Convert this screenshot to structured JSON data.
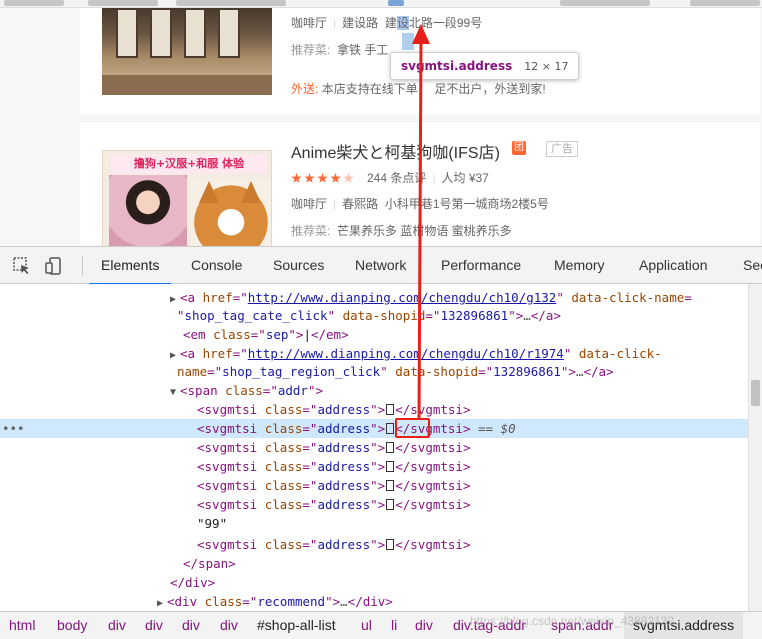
{
  "page": {
    "shop1": {
      "tags_line": {
        "category": "咖啡厅",
        "region": "建设路",
        "address_prefix": "建",
        "address_highlight": "设",
        "address_rest": "北路一段99号"
      },
      "recommend_label": "推荐菜:",
      "recommend_items": "拿铁 手工",
      "delivery_label": "外送:",
      "delivery_text": "本店支持在线下单",
      "delivery_text2": "足不出户，外送到家!"
    },
    "shop2": {
      "thumb_banner": "撸狗+汉服+和服 体验",
      "title": "Anime柴犬と柯基狗咖(IFS店)",
      "group_badge": "团",
      "ad_badge": "广告",
      "review_count": "244 条点评",
      "avg_price": "人均 ¥37",
      "rating_stars": 4,
      "rating_max": 5,
      "category": "咖啡厅",
      "region": "春熙路",
      "address": "小科甲巷1号第一城商场2楼5号",
      "recommend_label": "推荐菜:",
      "recommend_items": "芒果养乐多 蓝柑物语 蜜桃养乐多"
    },
    "tooltip": {
      "name": "svgmtsi.address",
      "size": "12 × 17"
    }
  },
  "devtools": {
    "tabs": [
      "Elements",
      "Console",
      "Sources",
      "Network",
      "Performance",
      "Memory",
      "Application",
      "Sec"
    ],
    "active_tab": "Elements",
    "dom": {
      "a1_href": "http://www.dianping.com/chengdu/ch10/g132",
      "a1_attr_click": "data-click-name",
      "a1_click_val": "shop_tag_cate_click",
      "shopid_attr": "data-shopid",
      "shopid_val": "132896861",
      "em_class": "sep",
      "a2_href": "http://www.dianping.com/chengdu/ch10/r1974",
      "a2_attr_click": "data-click-",
      "a2_attr_click2": "name",
      "a2_click_val": "shop_tag_region_click",
      "span_class": "addr",
      "svg_tag": "svgmtsi",
      "svg_class": "address",
      "text_99": "\"99\"",
      "selected_marker": "== $0",
      "div_class": "recommend",
      "ellipsis": "…",
      "row_dots": "•••"
    },
    "breadcrumbs": [
      "html",
      "body",
      "div",
      "div",
      "div",
      "div",
      "#shop-all-list",
      "ul",
      "li",
      "div",
      "div.tag-addr",
      "span.addr",
      "svgmtsi.address"
    ],
    "watermark": "https://blog.csdn.net/weixin_43882132"
  },
  "colors": {
    "accent": "#1a73e8",
    "tag": "#881280",
    "attr_name": "#994500",
    "attr_value": "#1a1aa6",
    "brand_orange": "#ff6633",
    "annotation_red": "#e8201a"
  }
}
